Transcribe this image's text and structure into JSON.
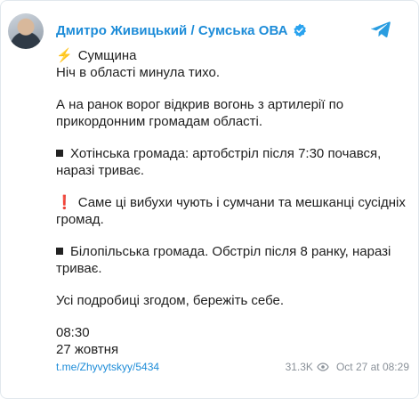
{
  "header": {
    "channel_name": "Дмитро Живицький / Сумська ОВА"
  },
  "post": {
    "title": "Сумщина",
    "line1": "Ніч в області минула тихо.",
    "line2a": "А на ранок ворог відкрив вогонь з артилерії по",
    "line2b": "прикордонним громадам області.",
    "line3a": "Хотінська громада: артобстріл після 7:30 почався,",
    "line3b": "наразі триває.",
    "line4a": "Саме ці вибухи чують і сумчани та мешканці сусідніх",
    "line4b": "громад.",
    "line5a": "Білопільська громада. Обстріл після 8 ранку, наразі",
    "line5b": "триває.",
    "line6": "Усі подробиці згодом, бережіть себе.",
    "time": "08:30",
    "date": "27 жовтня"
  },
  "footer": {
    "link": "t.me/Zhyvytskyy/5434",
    "views": "31.3K",
    "timestamp": "Oct 27 at 08:29"
  },
  "colors": {
    "accent": "#1d8cd8",
    "meta": "#8a9199",
    "text": "#1f1f1f"
  },
  "icons": {
    "title_emoji": "lightning-icon",
    "bullet": "black-square-icon",
    "warning": "red-exclamation-icon",
    "verified": "verified-badge-icon",
    "share": "telegram-icon",
    "views": "eye-icon"
  }
}
